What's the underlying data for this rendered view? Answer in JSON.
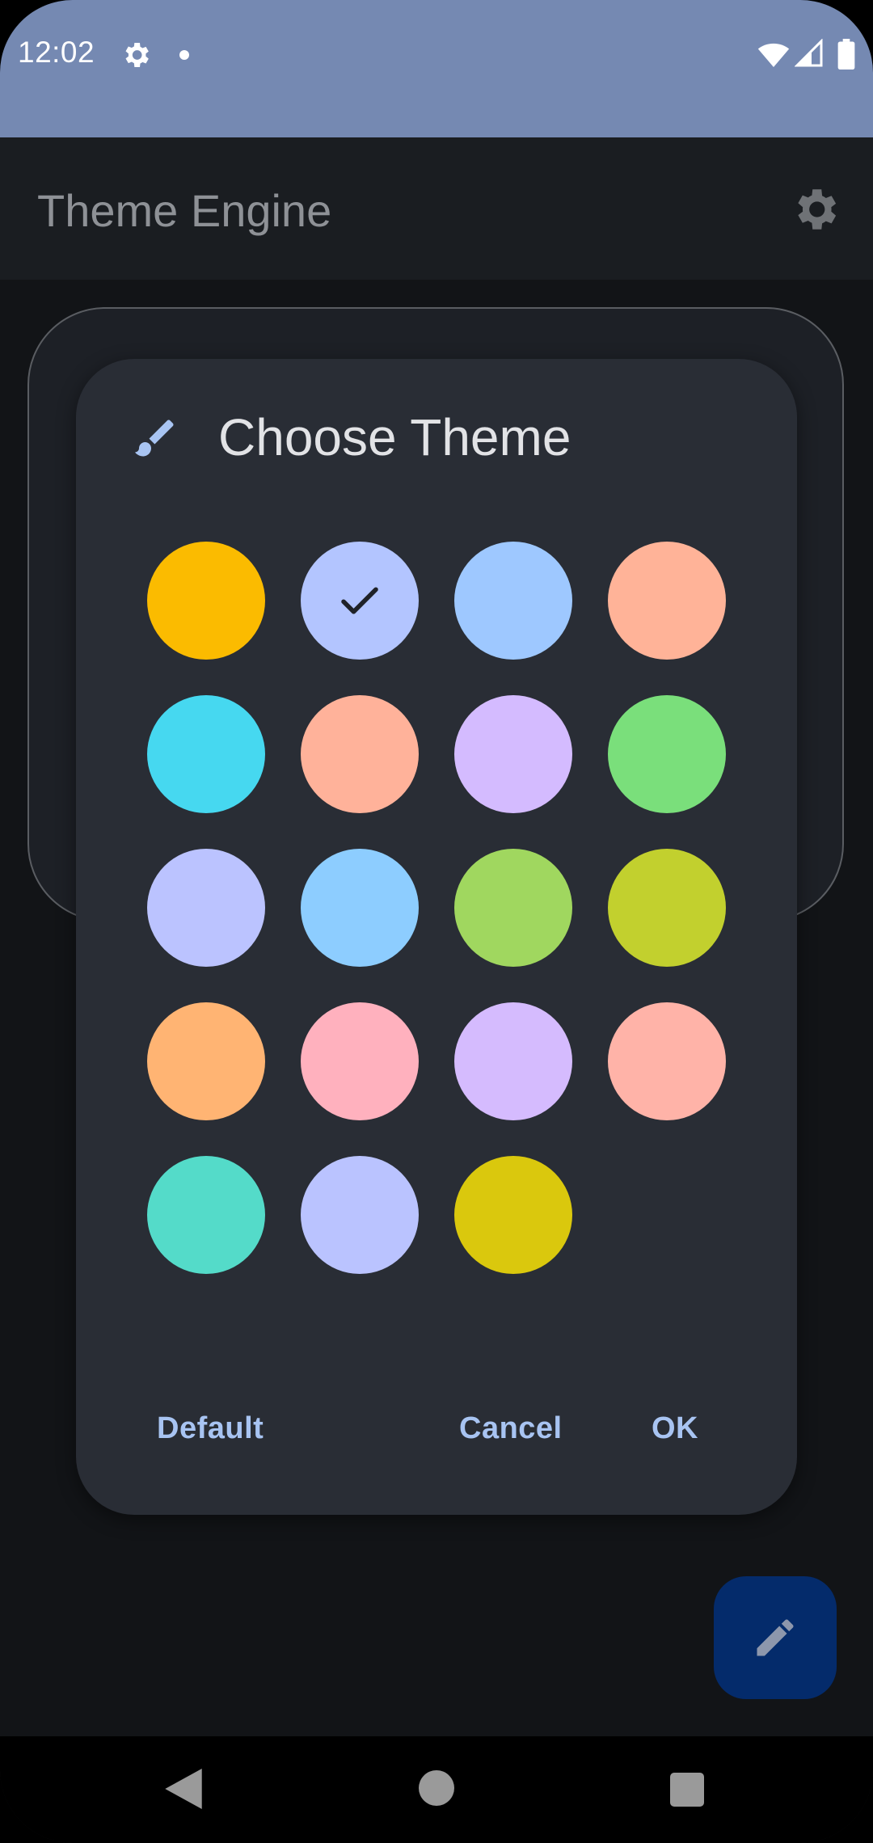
{
  "status_bar": {
    "time": "12:02",
    "icons": [
      "gear-icon",
      "notification-dot",
      "wifi-icon",
      "signal-icon",
      "battery-icon"
    ]
  },
  "app_bar": {
    "title": "Theme Engine",
    "settings_icon": "gear-icon"
  },
  "dialog": {
    "title": "Choose Theme",
    "title_icon": "paintbrush-icon",
    "swatches": [
      {
        "color": "#fbbb00",
        "selected": false
      },
      {
        "color": "#b3c5ff",
        "selected": true
      },
      {
        "color": "#9ec8ff",
        "selected": false
      },
      {
        "color": "#ffb398",
        "selected": false
      },
      {
        "color": "#46d8f0",
        "selected": false
      },
      {
        "color": "#ffb29a",
        "selected": false
      },
      {
        "color": "#d4bbff",
        "selected": false
      },
      {
        "color": "#7adf7b",
        "selected": false
      },
      {
        "color": "#bbc3ff",
        "selected": false
      },
      {
        "color": "#8dcdff",
        "selected": false
      },
      {
        "color": "#a0d75f",
        "selected": false
      },
      {
        "color": "#c2d02e",
        "selected": false
      },
      {
        "color": "#ffb473",
        "selected": false
      },
      {
        "color": "#ffb1be",
        "selected": false
      },
      {
        "color": "#d5bbfe",
        "selected": false
      },
      {
        "color": "#ffb3a8",
        "selected": false
      },
      {
        "color": "#54dbc9",
        "selected": false
      },
      {
        "color": "#bac3ff",
        "selected": false
      },
      {
        "color": "#dac80d",
        "selected": false
      }
    ],
    "buttons": {
      "default": "Default",
      "cancel": "Cancel",
      "ok": "OK"
    },
    "accent_color": "#a8c4f2"
  },
  "fab": {
    "icon": "pencil-icon",
    "color": "#042b6b"
  },
  "nav_bar": {
    "icons": [
      "back-icon",
      "home-icon",
      "recents-icon"
    ]
  }
}
